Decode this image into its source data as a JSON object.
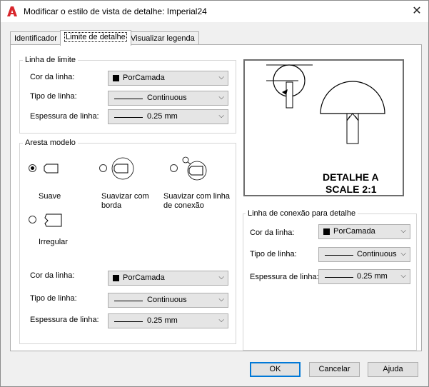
{
  "window": {
    "title": "Modificar o estilo de vista de detalhe: Imperial24",
    "close_glyph": "✕"
  },
  "tabs": [
    {
      "label": "Identificador",
      "active": false
    },
    {
      "label": "Limite de detalhe",
      "active": true
    },
    {
      "label": "Visualizar legenda",
      "active": false
    }
  ],
  "boundary": {
    "legend": "Linha de limite",
    "color_label": "Cor da linha:",
    "color_value": "PorCamada",
    "linetype_label": "Tipo de linha:",
    "linetype_value": "Continuous",
    "lineweight_label": "Espessura de linha:",
    "lineweight_value": "0.25 mm"
  },
  "model_edge": {
    "legend": "Aresta modelo",
    "options": [
      {
        "label": "Suave",
        "checked": true
      },
      {
        "label": "Suavizar com borda",
        "checked": false
      },
      {
        "label": "Suavizar com linha de conexão",
        "checked": false
      },
      {
        "label": "Irregular",
        "checked": false
      }
    ],
    "color_label": "Cor da linha:",
    "color_value": "PorCamada",
    "linetype_label": "Tipo de linha:",
    "linetype_value": "Continuous",
    "lineweight_label": "Espessura de linha:",
    "lineweight_value": "0.25 mm"
  },
  "preview": {
    "line1": "DETALHE A",
    "line2": "SCALE 2:1"
  },
  "connection": {
    "legend": "Linha de conexão para detalhe",
    "color_label": "Cor da linha:",
    "color_value": "PorCamada",
    "linetype_label": "Tipo de linha:",
    "linetype_value": "Continuous",
    "lineweight_label": "Espessura de linha:",
    "lineweight_value": "0.25 mm"
  },
  "buttons": {
    "ok": "OK",
    "cancel": "Cancelar",
    "help": "Ajuda"
  },
  "colors": {
    "accent": "#0078d7",
    "app_icon": "#d8262c"
  }
}
